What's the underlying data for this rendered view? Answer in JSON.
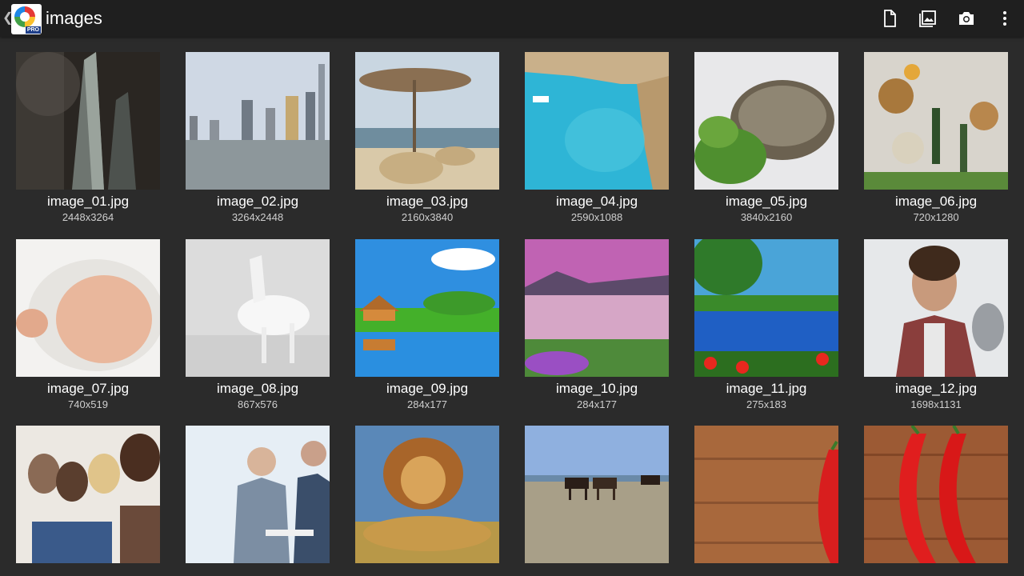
{
  "app": {
    "title": "images",
    "logo_badge": "PRO"
  },
  "toolbar": [
    {
      "icon": "file-icon"
    },
    {
      "icon": "gallery-icon"
    },
    {
      "icon": "camera-icon"
    },
    {
      "icon": "more-vert-icon"
    }
  ],
  "files": [
    {
      "name": "image_01.jpg",
      "dims": "2448x3264"
    },
    {
      "name": "image_02.jpg",
      "dims": "3264x2448"
    },
    {
      "name": "image_03.jpg",
      "dims": "2160x3840"
    },
    {
      "name": "image_04.jpg",
      "dims": "2590x1088"
    },
    {
      "name": "image_05.jpg",
      "dims": "3840x2160"
    },
    {
      "name": "image_06.jpg",
      "dims": "720x1280"
    },
    {
      "name": "image_07.jpg",
      "dims": "740x519"
    },
    {
      "name": "image_08.jpg",
      "dims": "867x576"
    },
    {
      "name": "image_09.jpg",
      "dims": "284x177"
    },
    {
      "name": "image_10.jpg",
      "dims": "284x177"
    },
    {
      "name": "image_11.jpg",
      "dims": "275x183"
    },
    {
      "name": "image_12.jpg",
      "dims": "1698x1131"
    },
    {
      "name": "",
      "dims": ""
    },
    {
      "name": "",
      "dims": ""
    },
    {
      "name": "",
      "dims": ""
    },
    {
      "name": "",
      "dims": ""
    },
    {
      "name": "",
      "dims": ""
    },
    {
      "name": "",
      "dims": ""
    }
  ]
}
